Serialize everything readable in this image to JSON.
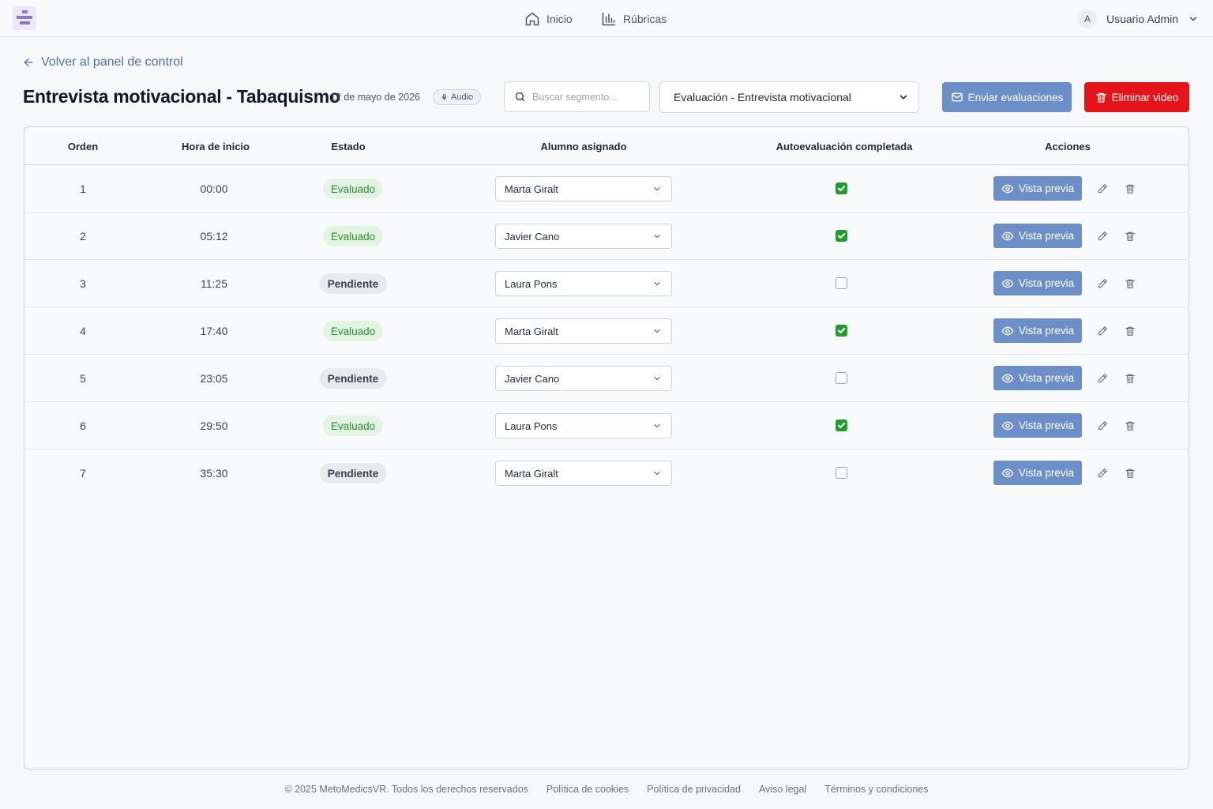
{
  "nav": {
    "home_label": "Inicio",
    "rubrics_label": "Rúbricas",
    "user_initial": "A",
    "user_name": "Usuario Admin"
  },
  "back_label": "Volver al panel de control",
  "video": {
    "title": "Entrevista motivacional - Tabaquismo",
    "date": "12 de mayo de 2026",
    "media_type": "Audio"
  },
  "search": {
    "placeholder": "Buscar segmento..."
  },
  "rubric_select": {
    "value": "Evaluación - Entrevista motivacional"
  },
  "actions": {
    "send_label": "Enviar evaluaciones",
    "delete_label": "Eliminar video"
  },
  "table": {
    "headers": [
      "Orden",
      "Hora de inicio",
      "Estado",
      "Alumno asignado",
      "Autoevaluación completada",
      "Acciones"
    ],
    "preview_label": "Vista previa",
    "rows": [
      {
        "order": "1",
        "start": "00:00",
        "status": "Evaluado",
        "student": "Marta Giralt",
        "self_eval": true
      },
      {
        "order": "2",
        "start": "05:12",
        "status": "Evaluado",
        "student": "Javier Cano",
        "self_eval": true
      },
      {
        "order": "3",
        "start": "11:25",
        "status": "Pendiente",
        "student": "Laura Pons",
        "self_eval": false
      },
      {
        "order": "4",
        "start": "17:40",
        "status": "Evaluado",
        "student": "Marta Giralt",
        "self_eval": true
      },
      {
        "order": "5",
        "start": "23:05",
        "status": "Pendiente",
        "student": "Javier Cano",
        "self_eval": false
      },
      {
        "order": "6",
        "start": "29:50",
        "status": "Evaluado",
        "student": "Laura Pons",
        "self_eval": true
      },
      {
        "order": "7",
        "start": "35:30",
        "status": "Pendiente",
        "student": "Marta Giralt",
        "self_eval": false
      }
    ]
  },
  "footer": {
    "copyright": "© 2025 MetoMedicsVR. Todos los derechos reservados",
    "links": [
      "Política de cookies",
      "Política de privacidad",
      "Aviso legal",
      "Términos y condiciones"
    ]
  },
  "colors": {
    "primary": "#6d8fc7",
    "danger": "#e3151b",
    "success_bg": "#e3f4e3",
    "success_text": "#2f8a34",
    "checkbox_on": "#1f9d2f"
  }
}
